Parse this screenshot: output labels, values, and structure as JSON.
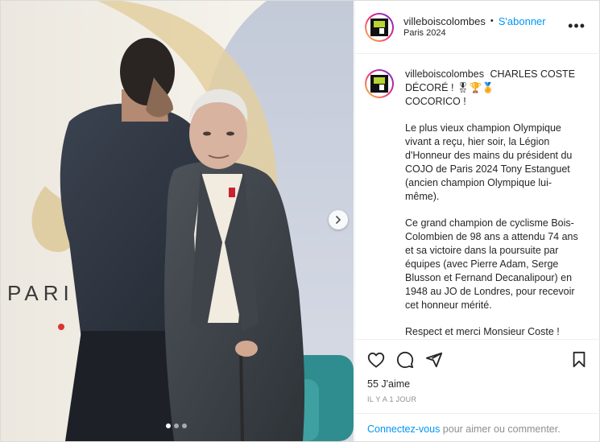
{
  "post": {
    "username": "villeboiscolombes",
    "follow_label": "S'abonner",
    "separator": "•",
    "location": "Paris 2024",
    "more_label": "•••"
  },
  "photo": {
    "backdrop_text": "PARI"
  },
  "caption": {
    "username": "villeboiscolombes",
    "title": "CHARLES COSTE DÉCORÉ ! 🎖🏆🏅",
    "line2": "COCORICO !",
    "paragraph1": "Le plus vieux champion Olympique vivant a reçu, hier soir, la Légion d'Honneur des mains du président du COJO de Paris 2024 Tony Estanguet (ancien champion Olympique lui-même).",
    "paragraph2": "Ce grand champion de cyclisme Bois-Colombien de 98 ans a attendu 74 ans et sa victoire dans la poursuite par équipes (avec Pierre Adam, Serge Blusson et Fernand Decanalipour) en 1948 au JO de Londres, pour recevoir cet honneur mérité.",
    "paragraph3": "Respect et merci Monsieur Coste !"
  },
  "footer": {
    "likes": "55 J'aime",
    "time": "IL Y A 1 JOUR",
    "login_link": "Connectez-vous",
    "login_text": " pour aimer ou commenter."
  },
  "carousel": {
    "slide_count": 3,
    "active_index": 0
  },
  "colors": {
    "accent": "#0095f6",
    "text": "#262626",
    "muted": "#8e8e8e",
    "border": "#dbdbdb",
    "logo_green": "#b7d433"
  },
  "icons": [
    "heart-icon",
    "comment-icon",
    "share-icon",
    "bookmark-icon",
    "chevron-right-icon",
    "more-icon"
  ]
}
